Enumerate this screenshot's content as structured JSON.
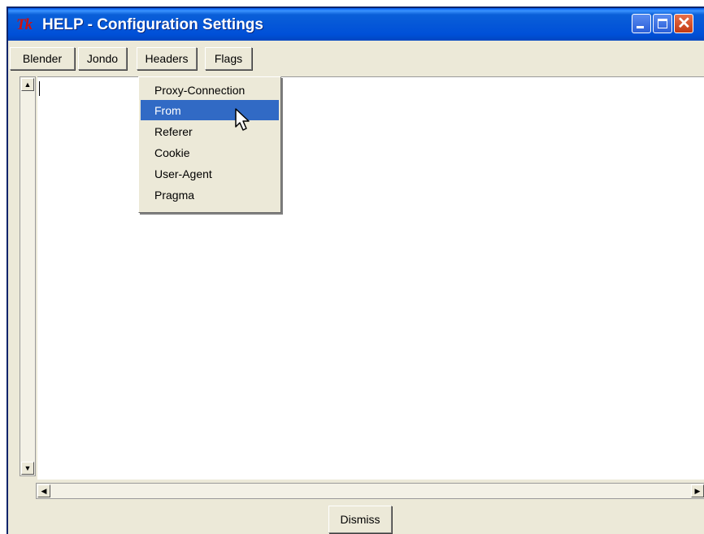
{
  "window": {
    "logo": "Tk",
    "title": "HELP - Configuration Settings",
    "controls": {
      "minimize_icon": "minimize-icon",
      "maximize_icon": "maximize-icon",
      "close_icon": "close-icon"
    }
  },
  "menubar": {
    "items": [
      {
        "label": "Blender"
      },
      {
        "label": "Jondo"
      },
      {
        "label": "Headers"
      },
      {
        "label": "Flags"
      }
    ]
  },
  "headers_menu": {
    "items": [
      {
        "label": "Proxy-Connection",
        "highlighted": false
      },
      {
        "label": "From",
        "highlighted": true
      },
      {
        "label": "Referer",
        "highlighted": false
      },
      {
        "label": "Cookie",
        "highlighted": false
      },
      {
        "label": "User-Agent",
        "highlighted": false
      },
      {
        "label": "Pragma",
        "highlighted": false
      }
    ]
  },
  "text_area": {
    "value": ""
  },
  "footer": {
    "dismiss_label": "Dismiss"
  },
  "colors": {
    "title_bar": "#0054e3",
    "highlight": "#316ac5",
    "window_bg": "#ece9d8",
    "close_button": "#c23a14"
  }
}
